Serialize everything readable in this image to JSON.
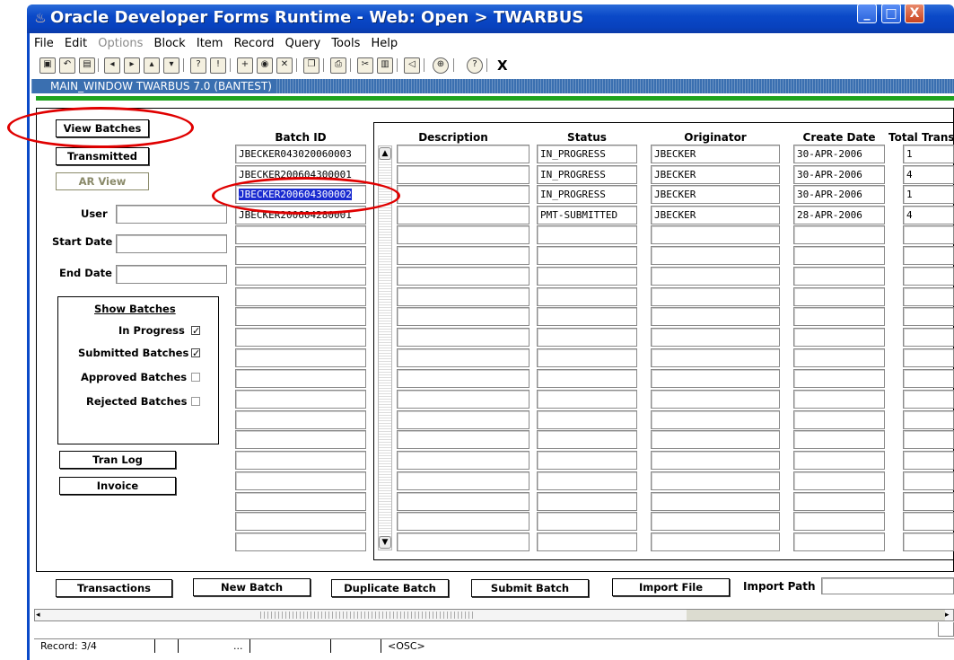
{
  "window": {
    "title": "Oracle Developer Forms Runtime - Web:  Open > TWARBUS",
    "min_glyph": "_",
    "max_glyph": "□",
    "close_glyph": "X"
  },
  "menu": [
    "File",
    "Edit",
    "Options",
    "Block",
    "Item",
    "Record",
    "Query",
    "Tools",
    "Help"
  ],
  "menu_disabled": [
    "Options"
  ],
  "toolbar": {
    "exit_label": "X"
  },
  "main_window": {
    "label": "MAIN_WINDOW  TWARBUS  7.0  (BANTEST)"
  },
  "left_panel": {
    "view_batches": "View Batches",
    "transmitted": "Transmitted",
    "ar_view": "AR View",
    "user_label": "User",
    "start_date_label": "Start Date",
    "end_date_label": "End Date",
    "show_batches": {
      "title": "Show Batches",
      "in_progress": "In Progress",
      "submitted": "Submitted Batches",
      "approved": "Approved Batches",
      "rejected": "Rejected Batches",
      "checks": {
        "in_progress": true,
        "submitted": true,
        "approved": false,
        "rejected": false
      }
    },
    "tran_log": "Tran Log",
    "invoice": "Invoice"
  },
  "grid": {
    "batch_id_header": "Batch ID",
    "columns": [
      "Description",
      "Status",
      "Originator",
      "Create Date",
      "Total Trans"
    ],
    "rows": [
      {
        "batch_id": "JBECKER043020060003",
        "description": "",
        "status": "IN_PROGRESS",
        "originator": "JBECKER",
        "create_date": "30-APR-2006",
        "total": "1"
      },
      {
        "batch_id": "JBECKER200604300001",
        "description": "",
        "status": "IN_PROGRESS",
        "originator": "JBECKER",
        "create_date": "30-APR-2006",
        "total": "4"
      },
      {
        "batch_id": "JBECKER200604300002",
        "description": "",
        "status": "IN_PROGRESS",
        "originator": "JBECKER",
        "create_date": "30-APR-2006",
        "total": "1"
      },
      {
        "batch_id": "JBECKER200604280001",
        "description": "",
        "status": "PMT-SUBMITTED",
        "originator": "JBECKER",
        "create_date": "28-APR-2006",
        "total": "4"
      }
    ],
    "selected_row": 2
  },
  "bottom_buttons": {
    "transactions": "Transactions",
    "new_batch": "New Batch",
    "duplicate_batch": "Duplicate Batch",
    "submit_batch": "Submit Batch",
    "import_file": "Import File",
    "import_path_label": "Import Path"
  },
  "statusbar": {
    "record": "Record: 3/4",
    "ellipsis": "...",
    "osc": "<OSC>"
  },
  "colors": {
    "title_blue": "#0a49c8",
    "highlight_red": "#e00000",
    "selection_blue": "#1a2bd0",
    "green_bar": "#1fa31f"
  }
}
